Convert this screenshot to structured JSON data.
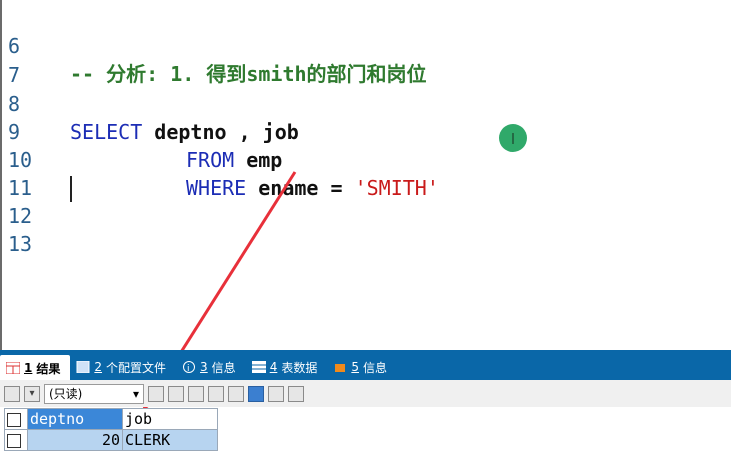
{
  "editor": {
    "lines": [
      {
        "num": "6",
        "comment": "-- 分析: 1. 得到smith的部门和岗位"
      },
      {
        "num": "7"
      },
      {
        "num": "8",
        "kw": "SELECT",
        "rest": " deptno , job"
      },
      {
        "num": "9",
        "kw": "FROM",
        "rest": " emp"
      },
      {
        "num": "10",
        "kw": "WHERE",
        "id": " ename = ",
        "str": "'SMITH'"
      },
      {
        "num": "11"
      },
      {
        "num": "12"
      },
      {
        "num": "13"
      }
    ]
  },
  "tabs": [
    {
      "num": "1",
      "label": "结果",
      "active": true
    },
    {
      "num": "2",
      "label": "个配置文件"
    },
    {
      "num": "3",
      "label": "信息"
    },
    {
      "num": "4",
      "label": "表数据"
    },
    {
      "num": "5",
      "label": "信息"
    }
  ],
  "toolbar": {
    "mode": "(只读)"
  },
  "results": {
    "columns": [
      "deptno",
      "job"
    ],
    "rows": [
      [
        "20",
        "CLERK"
      ]
    ]
  },
  "colors": {
    "tab_bar": "#0a67a8",
    "keyword": "#1c2db5",
    "string": "#c91a1a",
    "comment": "#2f7a2f",
    "line_number": "#2a5e8c"
  }
}
